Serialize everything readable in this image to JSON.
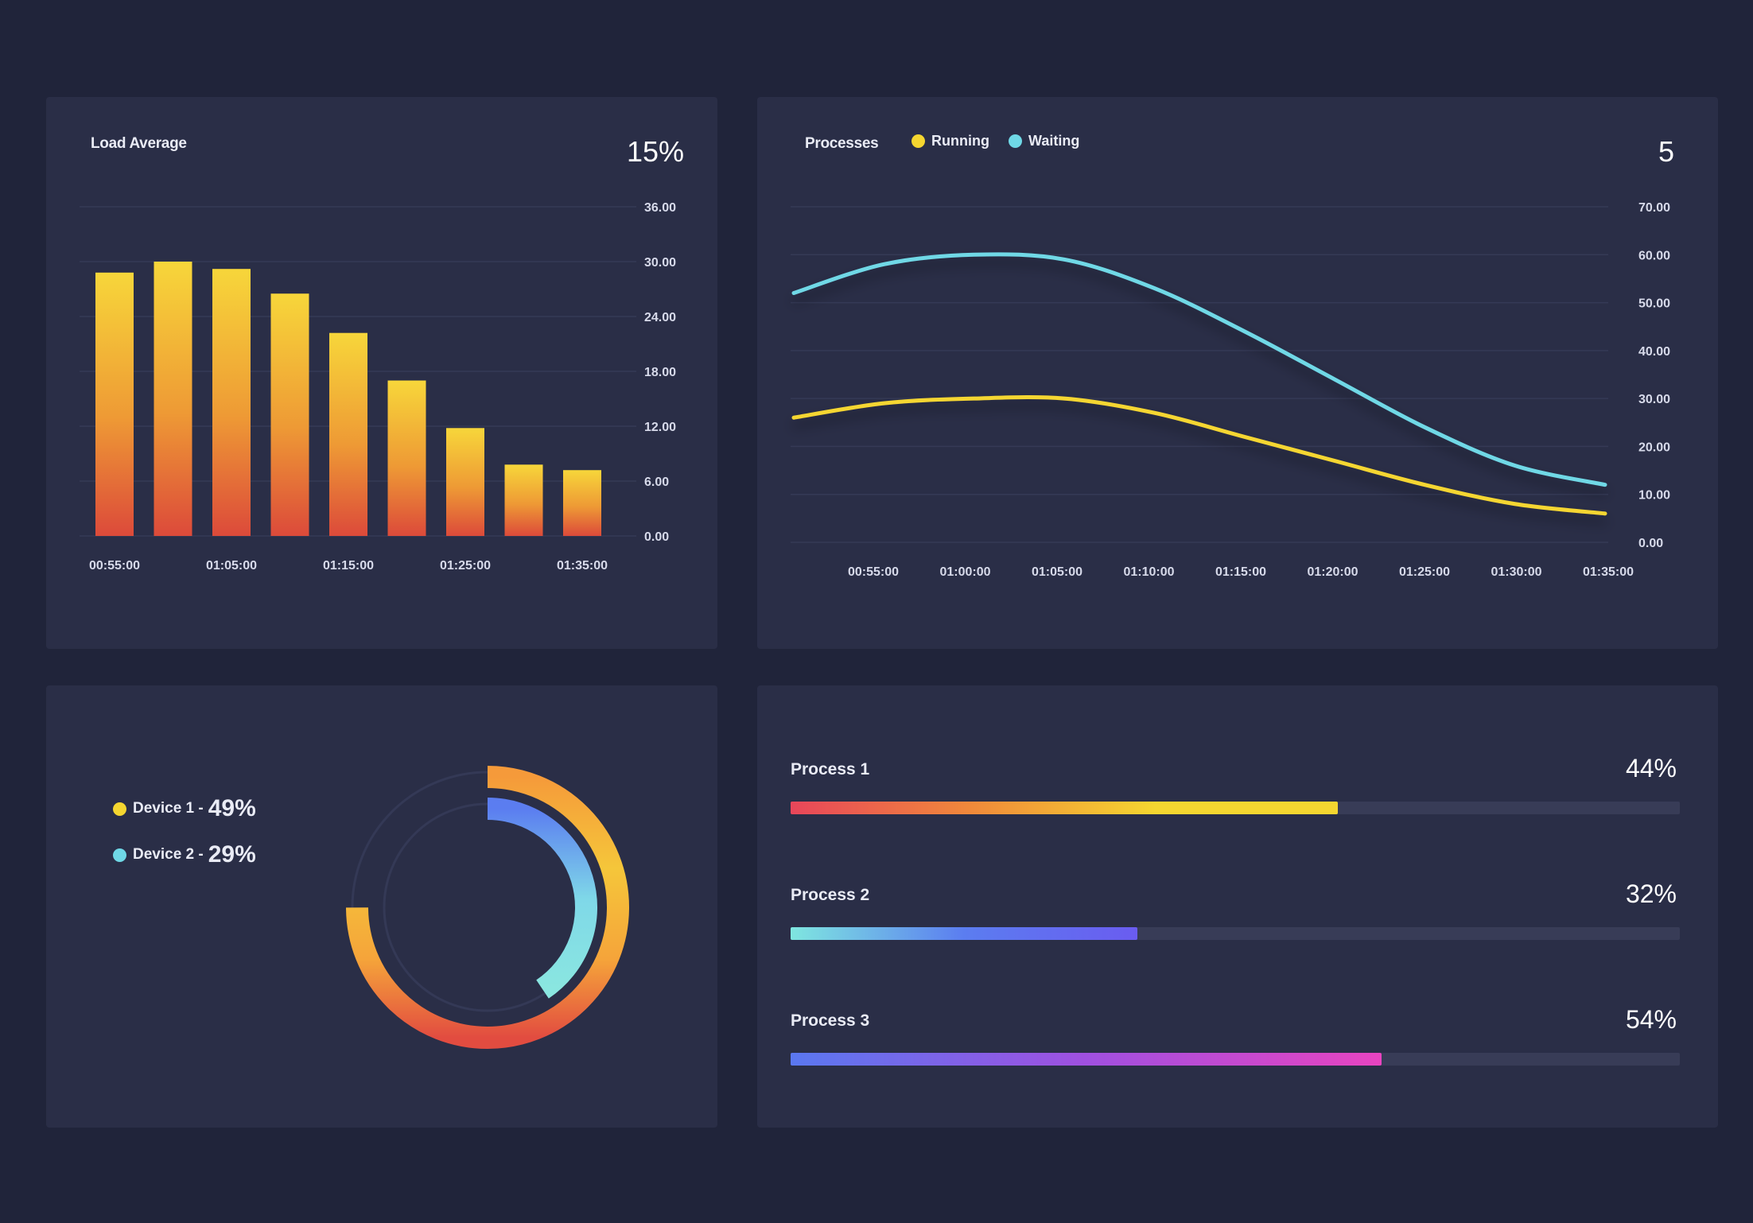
{
  "load_average": {
    "title": "Load Average",
    "value": "15%"
  },
  "processes": {
    "title": "Processes",
    "value": "5",
    "legend": [
      {
        "label": "Running",
        "color": "#f5d630"
      },
      {
        "label": "Waiting",
        "color": "#6fd8e6"
      }
    ]
  },
  "devices": [
    {
      "label": "Device 1 -",
      "value": "49%",
      "color": "#f5d630"
    },
    {
      "label": "Device 2 -",
      "value": "29%",
      "color": "#6fd8e6"
    }
  ],
  "process_bars": [
    {
      "name": "Process 1",
      "percent": "44%",
      "fill_fraction": 0.615,
      "gradient": [
        "#e8465a",
        "#f08a3a",
        "#f5d630",
        "#f5d630"
      ]
    },
    {
      "name": "Process 2",
      "percent": "32%",
      "fill_fraction": 0.39,
      "gradient": [
        "#7fe6e0",
        "#5b7df0",
        "#6a5cf0"
      ]
    },
    {
      "name": "Process 3",
      "percent": "54%",
      "fill_fraction": 0.665,
      "gradient": [
        "#5a78f0",
        "#a050e0",
        "#e844c0"
      ]
    }
  ],
  "chart_data": [
    {
      "type": "bar",
      "title": "Load Average",
      "x_tick_labels": [
        "00:55:00",
        "01:05:00",
        "01:15:00",
        "01:25:00",
        "01:35:00"
      ],
      "values": [
        28.8,
        30.0,
        29.2,
        26.5,
        22.2,
        17.0,
        11.8,
        7.8,
        7.2
      ],
      "y_tick_labels": [
        "36.00",
        "30.00",
        "24.00",
        "18.00",
        "12.00",
        "6.00",
        "0.00"
      ],
      "ylim": [
        0,
        36
      ]
    },
    {
      "type": "line",
      "title": "Processes",
      "x_tick_labels": [
        "00:55:00",
        "01:00:00",
        "01:05:00",
        "01:10:00",
        "01:15:00",
        "01:20:00",
        "01:25:00",
        "01:30:00",
        "01:35:00"
      ],
      "series": [
        {
          "name": "Waiting",
          "color": "#6fd8e6",
          "values": [
            52,
            58,
            60,
            59,
            53,
            44,
            34,
            24,
            16,
            12
          ]
        },
        {
          "name": "Running",
          "color": "#f5d630",
          "values": [
            26,
            29,
            30,
            30,
            27,
            22,
            17,
            12,
            8,
            6
          ]
        }
      ],
      "y_tick_labels": [
        "70.00",
        "60.00",
        "50.00",
        "40.00",
        "30.00",
        "20.00",
        "10.00",
        "0.00"
      ],
      "ylim": [
        0,
        70
      ]
    },
    {
      "type": "pie",
      "subtype": "radial",
      "series": [
        {
          "name": "Device 1",
          "value": 49
        },
        {
          "name": "Device 2",
          "value": 29
        }
      ]
    }
  ]
}
